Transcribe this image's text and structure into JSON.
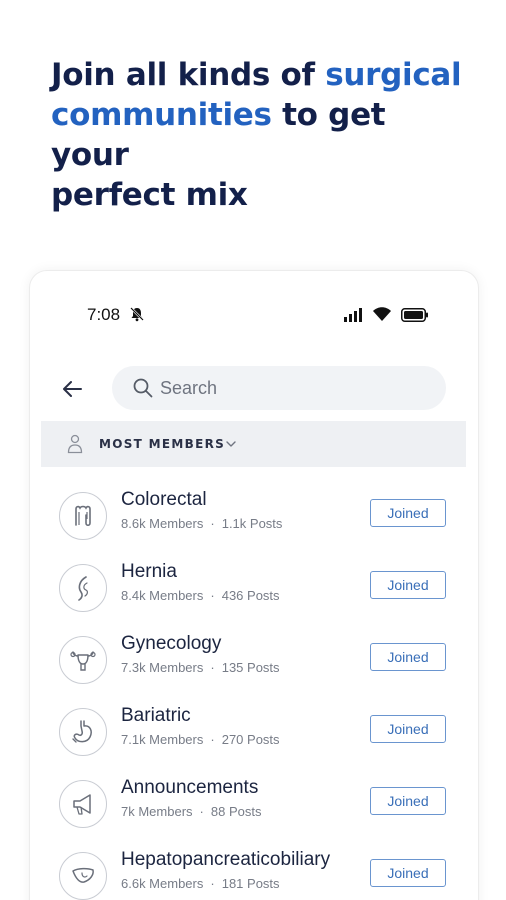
{
  "headline": {
    "part1": "Join all kinds of ",
    "accent1": "surgical",
    "accent2": "communities",
    "part2": " to get your",
    "part3": "perfect mix"
  },
  "status_bar": {
    "time": "7:08"
  },
  "search": {
    "placeholder": "Search"
  },
  "sort": {
    "label": "MOST MEMBERS"
  },
  "communities": [
    {
      "name": "Colorectal",
      "members": "8.6k Members",
      "posts": "1.1k Posts",
      "button": "Joined",
      "icon": "colon-icon"
    },
    {
      "name": "Hernia",
      "members": "8.4k Members",
      "posts": "436 Posts",
      "button": "Joined",
      "icon": "hernia-icon"
    },
    {
      "name": "Gynecology",
      "members": "7.3k Members",
      "posts": "135 Posts",
      "button": "Joined",
      "icon": "uterus-icon"
    },
    {
      "name": "Bariatric",
      "members": "7.1k Members",
      "posts": "270 Posts",
      "button": "Joined",
      "icon": "stomach-icon"
    },
    {
      "name": "Announcements",
      "members": "7k Members",
      "posts": "88 Posts",
      "button": "Joined",
      "icon": "megaphone-icon"
    },
    {
      "name": "Hepatopancreaticobiliary",
      "members": "6.6k Members",
      "posts": "181 Posts",
      "button": "Joined",
      "icon": "liver-icon"
    }
  ],
  "colors": {
    "headline": "#13204a",
    "accent": "#2362c0",
    "joined_border": "#6a95cf"
  }
}
